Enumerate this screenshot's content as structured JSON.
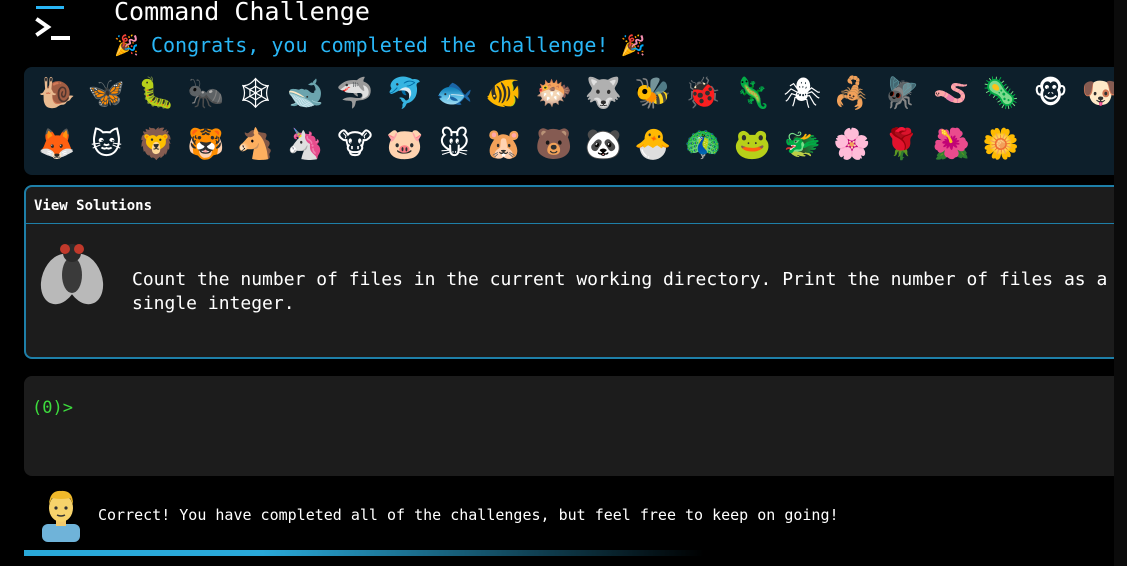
{
  "header": {
    "title": "Command Challenge",
    "subtitle": "Congrats, you completed the challenge!",
    "party_emoji": "🎉"
  },
  "animals": {
    "row1": [
      "🐌",
      "🦋",
      "🐛",
      "🐜",
      "🕸",
      "🐋",
      "🦈",
      "🐬",
      "🐟",
      "🐠",
      "🐡",
      "🐺",
      "🐝",
      "🐞",
      "🦎",
      "🕷",
      "🦂",
      "🪰",
      "🪱",
      "🦠",
      "🐵",
      "🐶"
    ],
    "row2": [
      "🦊",
      "🐱",
      "🦁",
      "🐯",
      "🐴",
      "🦄",
      "🐮",
      "🐷",
      "🐭",
      "🐹",
      "🐻",
      "🐼",
      "🐣",
      "🦚",
      "🐸",
      "🐲",
      "🌸",
      "🌹",
      "🌺",
      "🌼"
    ]
  },
  "solutions": {
    "header_label": "View Solutions",
    "challenge_text": "Count the number of files in the current working directory. Print the number of files as a single integer."
  },
  "terminal": {
    "prompt": "(0)>"
  },
  "message": {
    "text": "Correct! You have completed all of the challenges, but feel free to keep on going!"
  },
  "progress": {
    "fraction": 0.62,
    "color": "#29a8d8"
  }
}
